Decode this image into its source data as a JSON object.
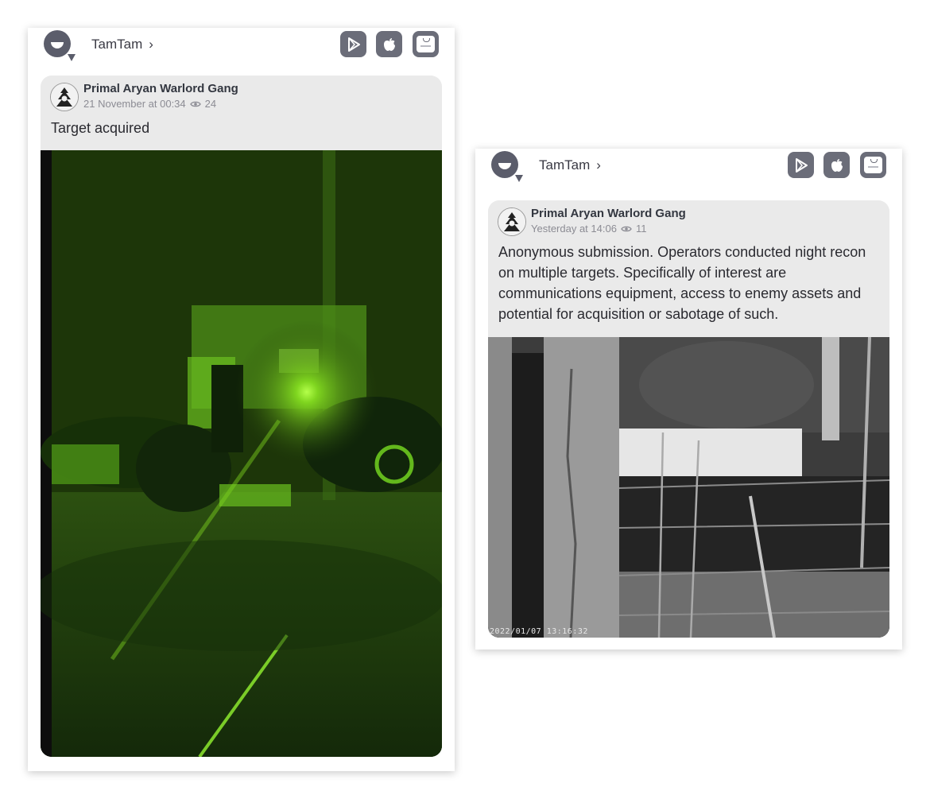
{
  "posts": [
    {
      "app_name": "TamTam",
      "chevron": "›",
      "store_icons": [
        "google-play-icon",
        "apple-icon",
        "huawei-appgallery-icon"
      ],
      "author": "Primal Aryan Warlord Gang",
      "date": "21 November at 00:34",
      "views": "24",
      "text": "Target acquired",
      "media": "night-vision-photo"
    },
    {
      "app_name": "TamTam",
      "chevron": "›",
      "store_icons": [
        "google-play-icon",
        "apple-icon",
        "huawei-appgallery-icon"
      ],
      "author": "Primal Aryan Warlord Gang",
      "date": "Yesterday at 14:06",
      "views": "11",
      "text": "Anonymous submission. Operators conducted night recon on multiple targets. Specifically of interest are communications equipment, access to enemy assets and potential for acquisition or sabotage of such.",
      "media": "security-camera-photo",
      "media_timestamp": "2022/01/07 13:16:32"
    }
  ],
  "colors": {
    "icon_grey": "#5b5d6b",
    "post_bg": "#eaeaea",
    "night_vision_green": "#7dff2a"
  }
}
